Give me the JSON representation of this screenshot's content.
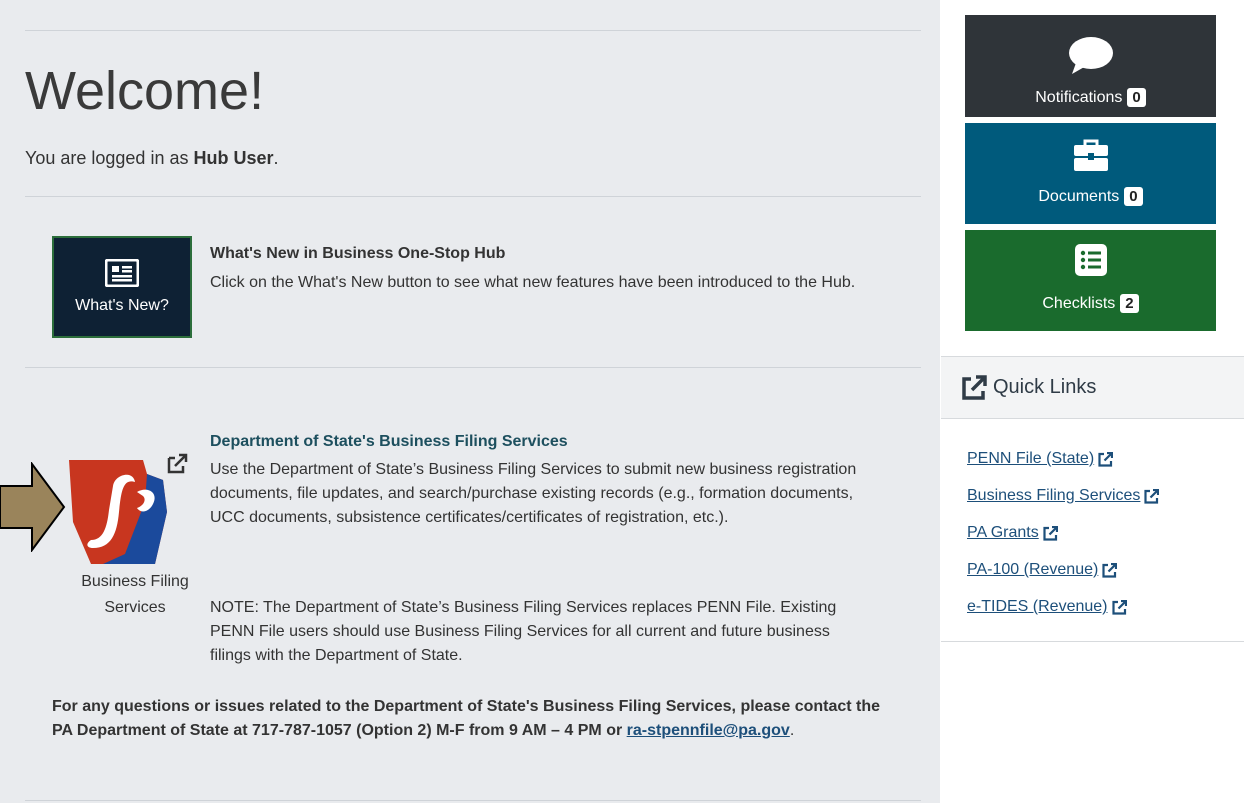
{
  "main": {
    "welcome_heading": "Welcome!",
    "logged_in_prefix": "You are logged in as ",
    "user_name": "Hub User",
    "logged_in_suffix": ".",
    "whats_new": {
      "button_label": "What's New?",
      "title": "What's New in Business One-Stop Hub",
      "description": "Click on the What's New button to see what new features have been introduced to the Hub."
    },
    "dos": {
      "logo_caption": "Business Filing Services",
      "title": "Department of State's Business Filing Services",
      "description": "Use the Department of State’s Business Filing Services to submit new business registration documents, file updates, and search/purchase existing records (e.g., formation documents, UCC documents, subsistence certificates/certificates of registration, etc.).",
      "note": "NOTE: The Department of State’s Business Filing Services replaces PENN File. Existing PENN File users should use Business Filing Services for all current and future business filings with the Department of State.",
      "contact_text": "For any questions or issues related to the Department of State's Business Filing Services, please contact the PA Department of State at 717-787-1057 (Option 2) M-F from 9 AM – 4 PM or ",
      "contact_email": "ra-stpennfile@pa.gov",
      "contact_end": "."
    }
  },
  "sidebar": {
    "tiles": [
      {
        "label": "Notifications",
        "count": "0",
        "icon": "speech-bubble-icon",
        "color": "#2f3439"
      },
      {
        "label": "Documents",
        "count": "0",
        "icon": "briefcase-icon",
        "color": "#005a7c"
      },
      {
        "label": "Checklists",
        "count": "2",
        "icon": "list-icon",
        "color": "#1a6b2d"
      }
    ],
    "quick_links": {
      "title": "Quick Links",
      "links": [
        "PENN File (State)",
        "Business Filing Services",
        "PA Grants",
        "PA-100 (Revenue)",
        "e-TIDES (Revenue)"
      ]
    }
  },
  "colors": {
    "main_bg": "#e9ebee",
    "link": "#1d4f7a",
    "arrow": "#9a845b"
  }
}
